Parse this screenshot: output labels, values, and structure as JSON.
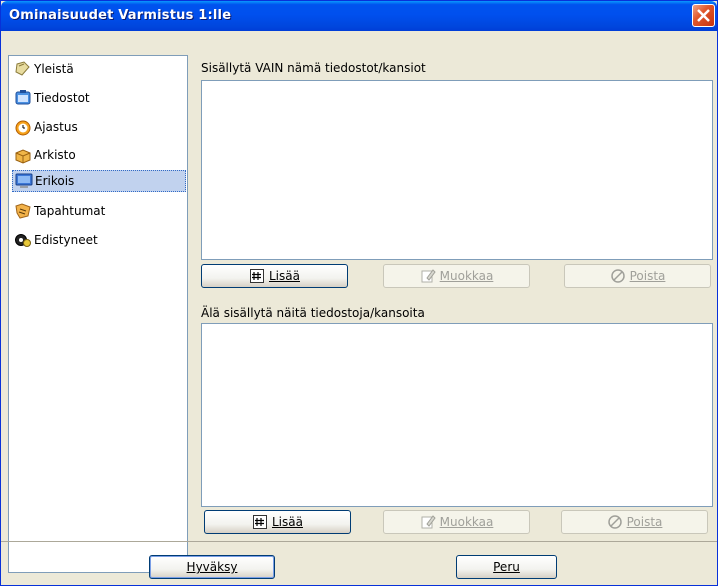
{
  "window": {
    "title": "Ominaisuudet Varmistus 1:lle"
  },
  "sidebar": {
    "items": [
      {
        "label": "Yleistä",
        "icon": "general-icon"
      },
      {
        "label": "Tiedostot",
        "icon": "files-icon"
      },
      {
        "label": "Ajastus",
        "icon": "clock-icon"
      },
      {
        "label": "Arkisto",
        "icon": "archive-icon"
      },
      {
        "label": "Erikois",
        "icon": "monitor-icon",
        "selected": true
      },
      {
        "label": "Tapahtumat",
        "icon": "events-icon"
      },
      {
        "label": "Edistyneet",
        "icon": "advanced-icon"
      }
    ]
  },
  "include": {
    "label": "Sisällytä VAIN nämä tiedostot/kansiot",
    "add": "Lisää",
    "edit": "Muokkaa",
    "remove": "Poista"
  },
  "exclude": {
    "label": "Älä sisällytä näitä tiedostoja/kansoita",
    "add": "Lisää",
    "edit": "Muokkaa",
    "remove": "Poista"
  },
  "footer": {
    "ok": "Hyväksy",
    "cancel": "Peru"
  },
  "colors": {
    "titlebar": "#0053ee",
    "selection": "#c1d2ee",
    "face": "#ece9d8"
  }
}
